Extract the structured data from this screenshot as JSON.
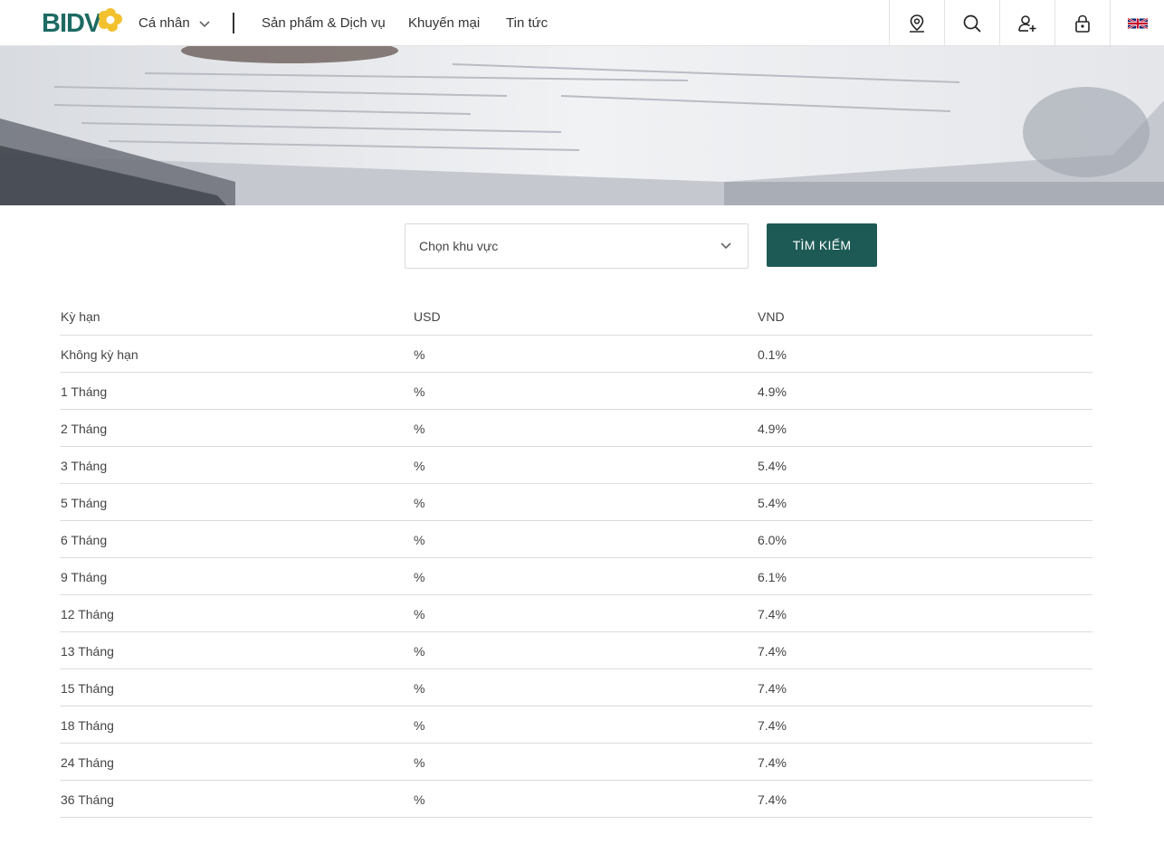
{
  "header": {
    "logo_text": "BIDV",
    "segment_label": "Cá nhân",
    "nav": [
      "Sản phẩm & Dịch vụ",
      "Khuyến mại",
      "Tin tức"
    ],
    "icons": [
      "map-pin-icon",
      "search-icon",
      "add-user-icon",
      "lock-icon",
      "uk-flag-icon"
    ],
    "brand_color": "#1d6a62",
    "logo_accent": "#f2c12e"
  },
  "search": {
    "region_select": "Chọn khu vực",
    "button_label": "TÌM KIẾM",
    "button_color": "#1d5a55"
  },
  "rates": {
    "columns": [
      "Kỳ hạn",
      "USD",
      "VND"
    ],
    "rows": [
      [
        "Không kỳ hạn",
        "%",
        "0.1%"
      ],
      [
        "1 Tháng",
        "%",
        "4.9%"
      ],
      [
        "2 Tháng",
        "%",
        "4.9%"
      ],
      [
        "3 Tháng",
        "%",
        "5.4%"
      ],
      [
        "5 Tháng",
        "%",
        "5.4%"
      ],
      [
        "6 Tháng",
        "%",
        "6.0%"
      ],
      [
        "9 Tháng",
        "%",
        "6.1%"
      ],
      [
        "12 Tháng",
        "%",
        "7.4%"
      ],
      [
        "13 Tháng",
        "%",
        "7.4%"
      ],
      [
        "15 Tháng",
        "%",
        "7.4%"
      ],
      [
        "18 Tháng",
        "%",
        "7.4%"
      ],
      [
        "24 Tháng",
        "%",
        "7.4%"
      ],
      [
        "36 Tháng",
        "%",
        "7.4%"
      ]
    ]
  }
}
